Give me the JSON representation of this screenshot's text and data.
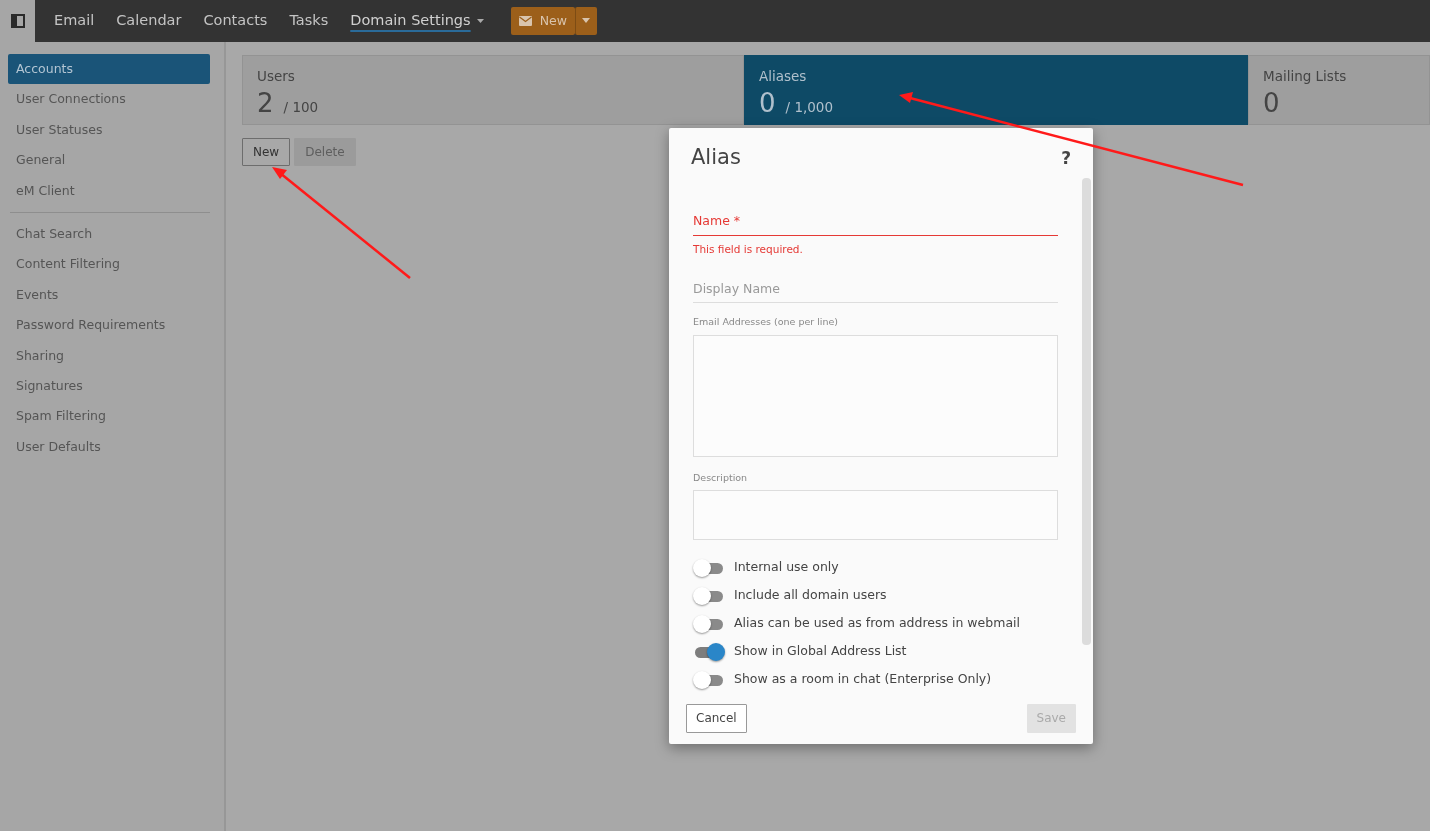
{
  "topbar": {
    "nav": [
      {
        "label": "Email",
        "selected": false,
        "dropdown": false
      },
      {
        "label": "Calendar",
        "selected": false,
        "dropdown": false
      },
      {
        "label": "Contacts",
        "selected": false,
        "dropdown": false
      },
      {
        "label": "Tasks",
        "selected": false,
        "dropdown": false
      },
      {
        "label": "Domain Settings",
        "selected": true,
        "dropdown": true
      }
    ],
    "new_button": {
      "label": "New"
    }
  },
  "sidebar": {
    "groups": [
      {
        "items": [
          {
            "label": "Accounts",
            "selected": true
          },
          {
            "label": "User Connections",
            "selected": false
          },
          {
            "label": "User Statuses",
            "selected": false
          },
          {
            "label": "General",
            "selected": false
          },
          {
            "label": "eM Client",
            "selected": false
          }
        ]
      },
      {
        "items": [
          {
            "label": "Chat Search",
            "selected": false
          },
          {
            "label": "Content Filtering",
            "selected": false
          },
          {
            "label": "Events",
            "selected": false
          },
          {
            "label": "Password Requirements",
            "selected": false
          },
          {
            "label": "Sharing",
            "selected": false
          },
          {
            "label": "Signatures",
            "selected": false
          },
          {
            "label": "Spam Filtering",
            "selected": false
          },
          {
            "label": "User Defaults",
            "selected": false
          }
        ]
      }
    ]
  },
  "tiles": [
    {
      "label": "Users",
      "count": "2",
      "limit": "/ 100",
      "selected": false
    },
    {
      "label": "Aliases",
      "count": "0",
      "limit": "/ 1,000",
      "selected": true
    },
    {
      "label": "Mailing Lists",
      "count": "0",
      "selected": false
    }
  ],
  "actions": [
    {
      "label": "New",
      "disabled": false
    },
    {
      "label": "Delete",
      "disabled": true
    }
  ],
  "dialog": {
    "title": "Alias",
    "help": "?",
    "fields": [
      {
        "kind": "line",
        "placeholder": "Name *",
        "invalid": true,
        "error": "This field is required."
      },
      {
        "kind": "line",
        "placeholder": "Display Name",
        "invalid": false
      },
      {
        "kind": "area",
        "label": "Email Addresses (one per line)"
      },
      {
        "kind": "area",
        "label": "Description"
      }
    ],
    "toggles": [
      {
        "label": "Internal use only",
        "on": false
      },
      {
        "label": "Include all domain users",
        "on": false
      },
      {
        "label": "Alias can be used as from address in webmail",
        "on": false
      },
      {
        "label": "Show in Global Address List",
        "on": true
      },
      {
        "label": "Show as a room in chat (Enterprise Only)",
        "on": false
      }
    ],
    "buttons": [
      {
        "label": "Cancel",
        "disabled": false
      },
      {
        "label": "Save",
        "disabled": true
      }
    ]
  }
}
